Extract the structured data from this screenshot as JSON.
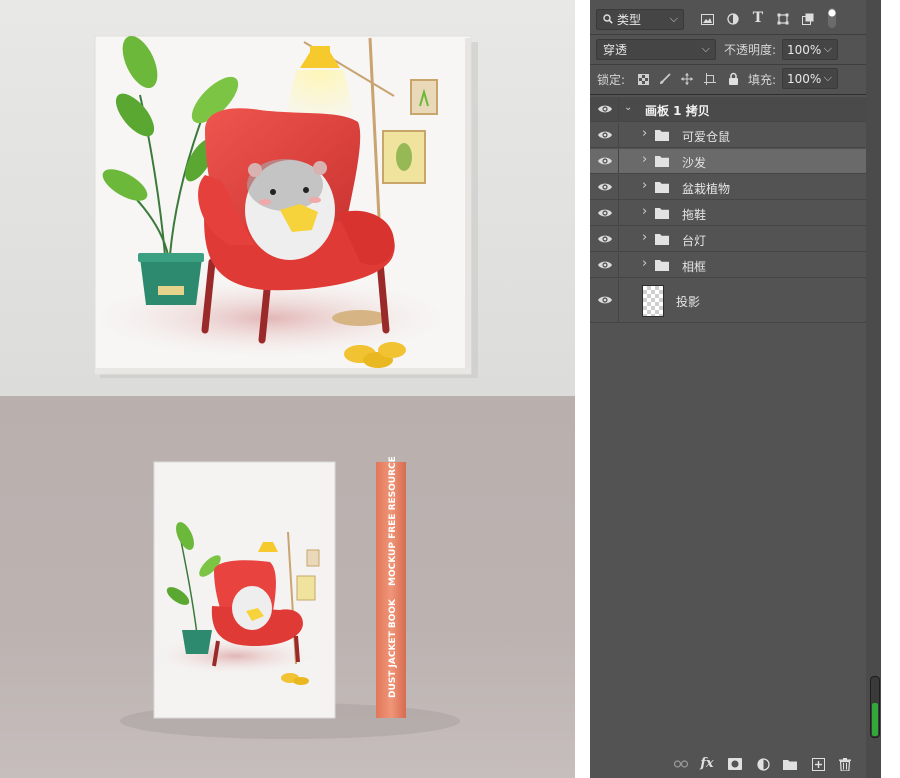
{
  "preview": {
    "spine_text_top": "MOCKUP FREE RESOURCE",
    "spine_text_bottom": "DUST JACKET BOOK"
  },
  "layers_panel": {
    "filter": {
      "label": "类型"
    },
    "blend": {
      "mode": "穿透"
    },
    "opacity": {
      "label": "不透明度:",
      "value": "100%"
    },
    "lock": {
      "label": "锁定:"
    },
    "fill": {
      "label": "填充:",
      "value": "100%"
    },
    "toolbar_icons": [
      "image-filter-icon",
      "adjustment-filter-icon",
      "type-filter-icon",
      "shape-filter-icon",
      "smart-object-filter-icon",
      "filter-toggle-icon"
    ],
    "lock_icons": [
      "lock-transparent-icon",
      "lock-paint-icon",
      "lock-position-icon",
      "lock-artboard-icon",
      "lock-all-icon"
    ],
    "layers": [
      {
        "name": "画板 1 拷贝",
        "type": "artboard",
        "visible": true,
        "expanded": true
      },
      {
        "name": "可爱仓鼠",
        "type": "group",
        "visible": true
      },
      {
        "name": "沙发",
        "type": "group",
        "visible": true,
        "selected": true
      },
      {
        "name": "盆栽植物",
        "type": "group",
        "visible": true
      },
      {
        "name": "拖鞋",
        "type": "group",
        "visible": true
      },
      {
        "name": "台灯",
        "type": "group",
        "visible": true
      },
      {
        "name": "相框",
        "type": "group",
        "visible": true
      },
      {
        "name": "投影",
        "type": "layer",
        "visible": true
      }
    ],
    "bottom_icons": [
      "link-layers-icon",
      "fx-icon",
      "mask-icon",
      "adjustment-layer-icon",
      "new-group-icon",
      "new-layer-icon",
      "trash-icon"
    ],
    "colors": {
      "panel_bg": "#535353",
      "selected_row": "#6a6a6a",
      "indicator": "#32a83a"
    }
  }
}
